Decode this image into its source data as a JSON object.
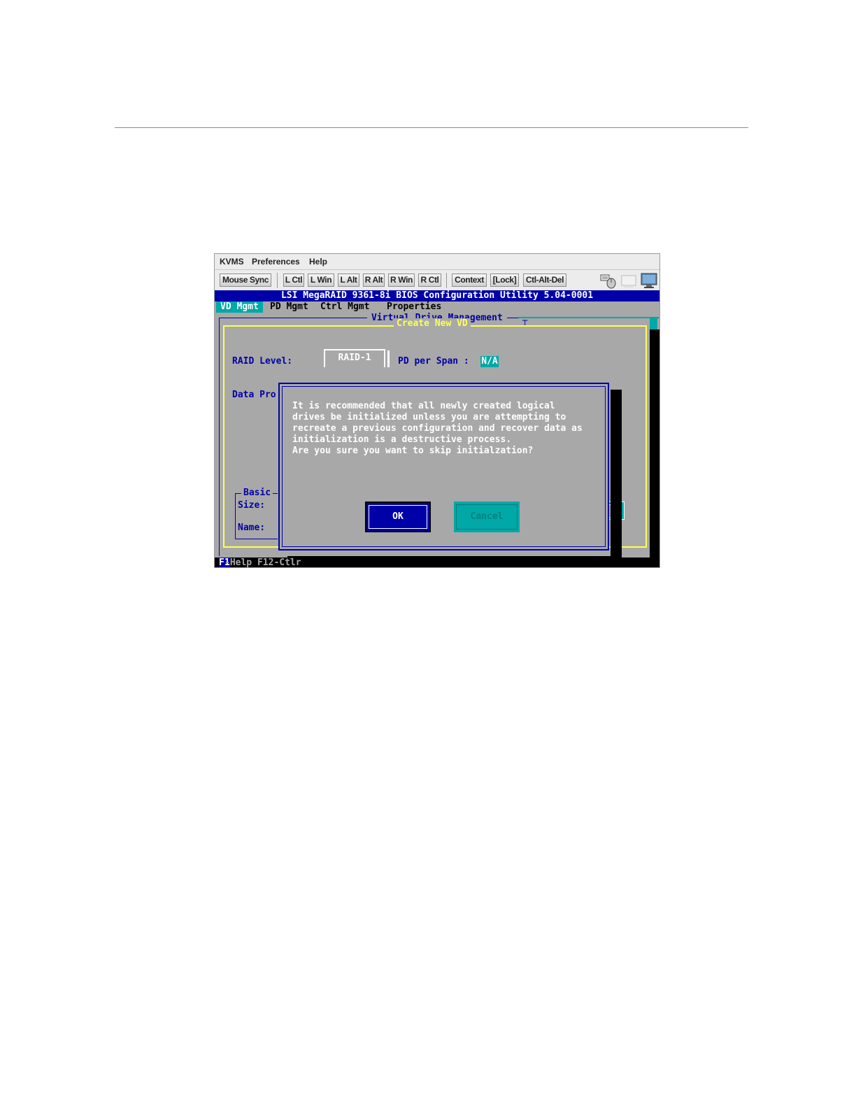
{
  "menubar": {
    "items": [
      "KVMS",
      "Preferences",
      "Help"
    ]
  },
  "toolbar": {
    "buttons": [
      "Mouse Sync",
      "L Ctl",
      "L Win",
      "L Alt",
      "R Alt",
      "R Win",
      "R Ctl",
      "Context",
      "[Lock]",
      "Ctl-Alt-Del"
    ],
    "icons": [
      "keyboard-mouse-icon",
      "blank-display-icon",
      "monitor-icon"
    ]
  },
  "bios": {
    "title": "LSI MegaRAID 9361-8i BIOS Configuration Utility 5.04-0001",
    "tabs": [
      "VD Mgmt",
      "PD Mgmt",
      "Ctrl Mgmt",
      "Properties"
    ],
    "panel_title": "Virtual Drive Management",
    "create_title": "Create New VD",
    "raid_level_label": "RAID Level:",
    "raid_level_value": "RAID-1",
    "pd_per_span_label": "PD per Span :",
    "pd_per_span_value": "N/A",
    "data_protection_label": "Data Pro",
    "basic_label": "Basic",
    "size_label": "Size:",
    "name_label": "Name:",
    "statusbar_key": "F1",
    "statusbar_text": "-Help F12-Ctlr"
  },
  "dialog": {
    "message": "It is recommended that all newly created logical\ndrives be initialized unless you are attempting to\nrecreate a previous configuration and recover data as\ninitialization is a destructive process.\nAre you sure you want to skip initialzation?",
    "ok_label": "OK",
    "cancel_label": "Cancel"
  },
  "colors": {
    "bios_blue": "#0000a8",
    "bios_gray": "#a8a8a8",
    "bios_cyan": "#00a8a8",
    "bios_yellow": "#ffff55"
  }
}
